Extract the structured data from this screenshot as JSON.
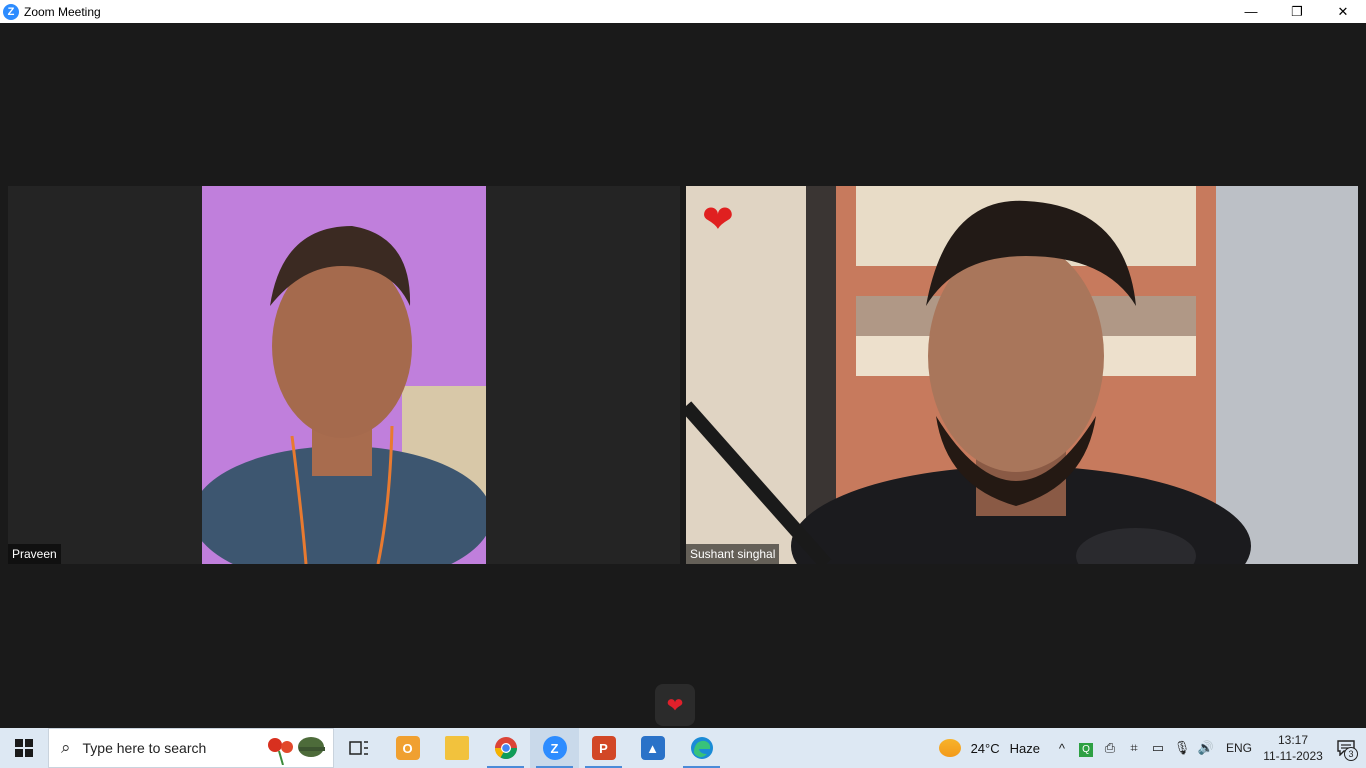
{
  "window": {
    "title": "Zoom Meeting",
    "minimize": "—",
    "restore": "❐",
    "close": "✕"
  },
  "participants": [
    {
      "name": "Praveen"
    },
    {
      "name": "Sushant singhal"
    }
  ],
  "reaction": {
    "icon": "heart-icon"
  },
  "taskbar": {
    "search_placeholder": "Type here to search",
    "apps": [
      "task-view",
      "outlook",
      "file-explorer",
      "chrome",
      "zoom",
      "powerpoint",
      "photos",
      "edge"
    ],
    "weather": {
      "temp": "24°C",
      "condition": "Haze"
    },
    "tray": {
      "chevron": "^",
      "lang": "ENG"
    },
    "clock": {
      "time": "13:17",
      "date": "11-11-2023"
    },
    "notifications": {
      "count": "3"
    }
  },
  "colors": {
    "zoom_blue": "#2d8cff",
    "heart_red": "#e02020",
    "meeting_bg": "#1a1a1a"
  }
}
